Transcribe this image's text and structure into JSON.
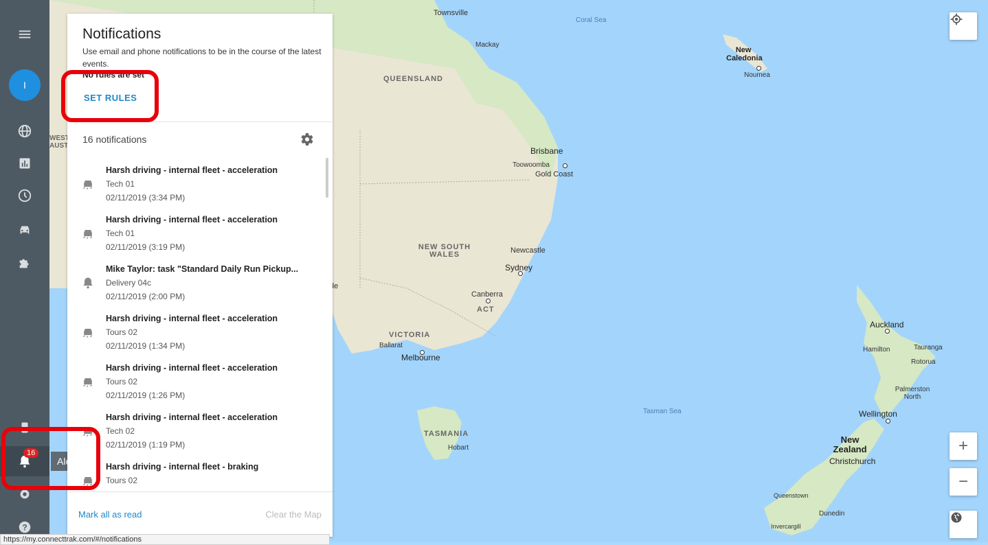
{
  "panel": {
    "title": "Notifications",
    "description": "Use email and phone notifications to be in the course of the latest events.",
    "rules_status": "No rules are set",
    "set_rules_label": "SET RULES",
    "count_label": "16 notifications",
    "mark_all_read": "Mark all as read",
    "clear_map": "Clear the Map"
  },
  "notifications": [
    {
      "title": "Harsh driving - internal fleet - acceleration",
      "vehicle": "Tech 01",
      "time": "02/11/2019 (3:34 PM)",
      "icon": "car-skid-icon"
    },
    {
      "title": "Harsh driving - internal fleet - acceleration",
      "vehicle": "Tech 01",
      "time": "02/11/2019 (3:19 PM)",
      "icon": "car-skid-icon"
    },
    {
      "title": "Mike Taylor: task \"Standard Daily Run Pickup...",
      "vehicle": "Delivery 04c",
      "time": "02/11/2019 (2:00 PM)",
      "icon": "bell-icon"
    },
    {
      "title": "Harsh driving - internal fleet - acceleration",
      "vehicle": "Tours 02",
      "time": "02/11/2019 (1:34 PM)",
      "icon": "car-skid-icon"
    },
    {
      "title": "Harsh driving - internal fleet - acceleration",
      "vehicle": "Tours 02",
      "time": "02/11/2019 (1:26 PM)",
      "icon": "car-skid-icon"
    },
    {
      "title": "Harsh driving - internal fleet - acceleration",
      "vehicle": "Tech 02",
      "time": "02/11/2019 (1:19 PM)",
      "icon": "car-skid-icon"
    },
    {
      "title": "Harsh driving - internal fleet - braking",
      "vehicle": "Tours 02",
      "time": "",
      "icon": "car-skid-icon"
    }
  ],
  "sidebar": {
    "avatar_initial": "I",
    "alerts_badge": "16",
    "alerts_tooltip": "Alerts"
  },
  "map": {
    "labels": {
      "townsville": "Townsville",
      "coral_sea": "Coral Sea",
      "mackay": "Mackay",
      "queensland": "QUEENSLAND",
      "new_caledonia": "New Caledonia",
      "noumea": "Noumea",
      "brisbane": "Brisbane",
      "toowoomba": "Toowoomba",
      "gold_coast": "Gold Coast",
      "new_south_wales": "NEW SOUTH WALES",
      "newcastle": "Newcastle",
      "sydney": "Sydney",
      "canberra": "Canberra",
      "act": "ACT",
      "victoria": "VICTORIA",
      "ballarat": "Ballarat",
      "melbourne": "Melbourne",
      "tasmania": "TASMANIA",
      "hobart": "Hobart",
      "tasman_sea": "Tasman Sea",
      "auckland": "Auckland",
      "hamilton": "Hamilton",
      "tauranga": "Tauranga",
      "rotorua": "Rotorua",
      "palmerston_north": "Palmerston North",
      "wellington": "Wellington",
      "new_zealand": "New Zealand",
      "christchurch": "Christchurch",
      "queenstown": "Queenstown",
      "dunedin": "Dunedin",
      "invercargill": "Invercargill",
      "west_aus": "WEST AUSTR",
      "adelaide_fragment": "de"
    }
  },
  "status_bar": {
    "url": "https://my.connecttrak.com/#/notifications"
  },
  "colors": {
    "accent": "#1e88c8",
    "sidebar": "#4e5a63",
    "highlight": "#e8000a",
    "badge": "#e02020"
  }
}
